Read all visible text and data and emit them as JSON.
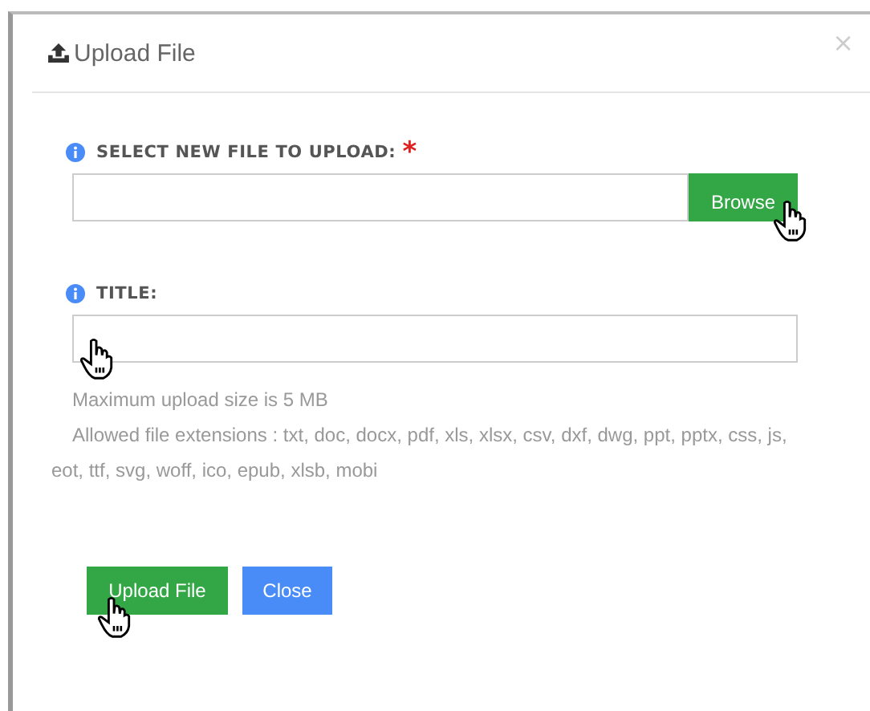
{
  "dialog": {
    "title": "Upload File",
    "close": "×"
  },
  "fields": [
    {
      "kind": "file",
      "label": "SELECT NEW FILE TO UPLOAD:",
      "required": true,
      "required_mark": "*",
      "button": "Browse"
    },
    {
      "kind": "text",
      "label": "TITLE:"
    }
  ],
  "help": [
    "Maximum upload size is 5 MB",
    "Allowed file extensions : txt, doc, docx, pdf, xls, xlsx, csv, dxf, dwg, ppt, pptx, css, js, eot, ttf, svg, woff, ico, epub, xlsb, mobi"
  ],
  "buttons": [
    {
      "label": "Upload File",
      "kind": "primary"
    },
    {
      "label": "Close",
      "kind": "secondary"
    }
  ]
}
